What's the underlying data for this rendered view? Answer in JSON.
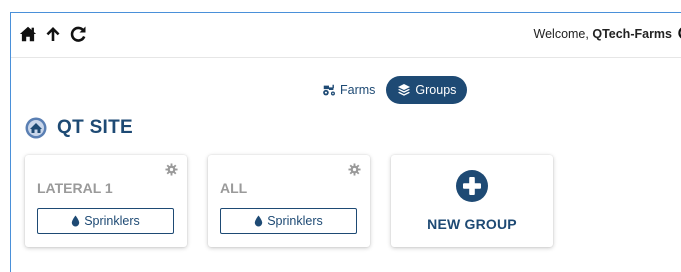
{
  "header": {
    "nav_icons": [
      "home-icon",
      "arrow-up-icon",
      "refresh-icon"
    ],
    "welcome_prefix": "Welcome, ",
    "username": "QTech-Farms",
    "user_icon": "user-circle-icon"
  },
  "view_toggle": {
    "options": [
      {
        "label": "Farms",
        "icon": "tractor-icon",
        "active": false
      },
      {
        "label": "Groups",
        "icon": "layers-icon",
        "active": true
      }
    ]
  },
  "site": {
    "logo_icon": "site-logo-icon",
    "name": "QT SITE"
  },
  "groups": [
    {
      "title": "LATERAL 1",
      "button_label": "Sprinklers",
      "button_icon": "droplet-icon",
      "settings_icon": "gear-icon"
    },
    {
      "title": "ALL",
      "button_label": "Sprinklers",
      "button_icon": "droplet-icon",
      "settings_icon": "gear-icon"
    }
  ],
  "new_group": {
    "label": "NEW GROUP",
    "icon": "plus-circle-icon"
  },
  "colors": {
    "accent": "#1e4a74",
    "frame_border": "#4a90d9",
    "muted_title": "#9a9a9a"
  }
}
